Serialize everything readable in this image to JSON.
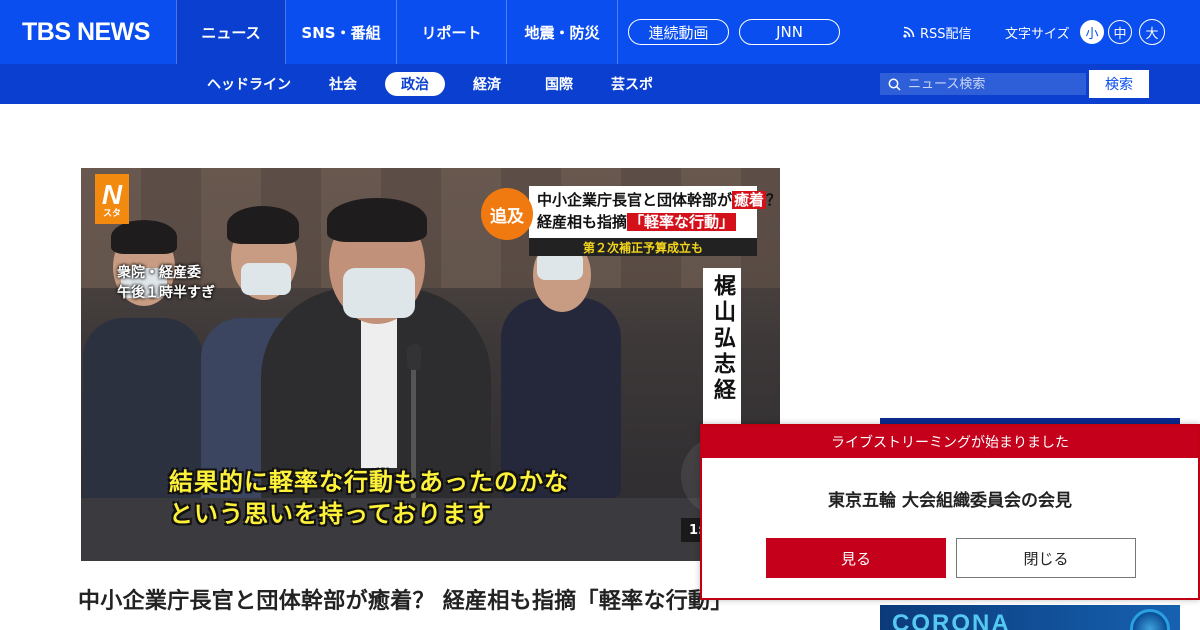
{
  "header": {
    "logo": "TBS NEWS",
    "nav": [
      "ニュース",
      "SNS・番組",
      "リポート",
      "地震・防災"
    ],
    "pills": [
      "連続動画",
      "JNN"
    ],
    "rss": "RSS配信",
    "font_size_label": "文字サイズ",
    "font_sizes": [
      "小",
      "中",
      "大"
    ]
  },
  "subnav": {
    "items": [
      "ヘッドライン",
      "社会",
      "政治",
      "経済",
      "国際",
      "芸スポ"
    ],
    "active": "政治",
    "search_placeholder": "ニュース検索",
    "search_button": "検索"
  },
  "video": {
    "badge": "N",
    "badge_sub": "スタ",
    "tag": "追及",
    "headline_line1_a": "中小企業庁長官と団体幹部が",
    "headline_line1_accent": "癒着",
    "headline_line1_b": "？",
    "headline_line2_a": "経産相も指摘",
    "headline_line2_accent": "「軽率な行動」",
    "headline_sub": "第２次補正予算成立も",
    "location_line1": "衆院・経産委",
    "location_line2": "午後１時半すぎ",
    "speaker": "梶山弘志",
    "speaker_tail": "経",
    "subtitle_line1": "結果的に軽率な行動もあったのかな",
    "subtitle_line2": "という思いを持っております",
    "duration": "1:"
  },
  "article": {
    "title": "中小企業庁長官と団体幹部が癒着？ 経産相も指摘「軽率な行動」"
  },
  "ad": {
    "bottom_text": "CORONA"
  },
  "modal": {
    "header": "ライブストリーミングが始まりました",
    "title": "東京五輪 大会組織委員会の会見",
    "watch": "見る",
    "close": "閉じる"
  }
}
